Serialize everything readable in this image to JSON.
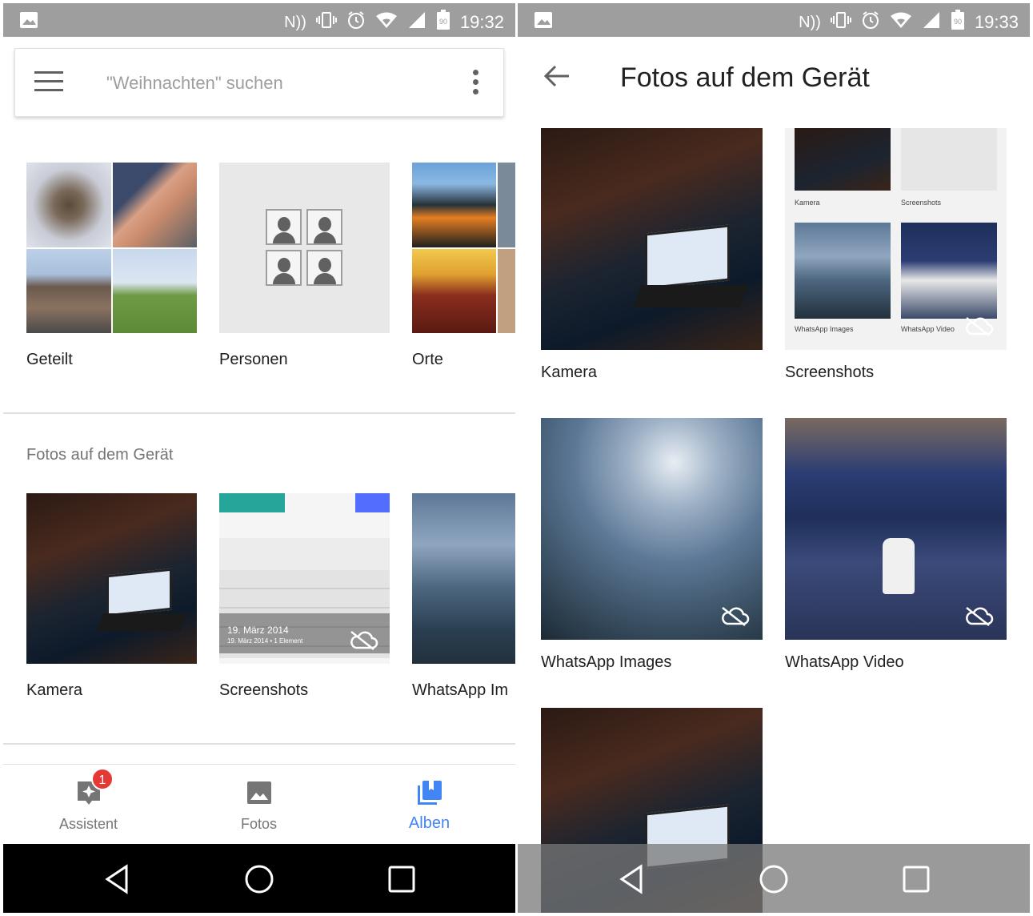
{
  "left": {
    "status": {
      "time": "19:32",
      "battery": "90"
    },
    "search": {
      "placeholder": "\"Weihnachten\" suchen"
    },
    "albums_top": [
      {
        "label": "Geteilt"
      },
      {
        "label": "Personen"
      },
      {
        "label": "Orte"
      }
    ],
    "device_section": {
      "title": "Fotos auf dem Gerät",
      "items": [
        {
          "label": "Kamera"
        },
        {
          "label": "Screenshots",
          "overlay_date": "19. März 2014",
          "overlay_sub": "19. März 2014 • 1 Element"
        },
        {
          "label": "WhatsApp Im"
        }
      ]
    },
    "bottom_nav": {
      "items": [
        {
          "label": "Assistent",
          "icon": "assistant-icon",
          "badge": "1"
        },
        {
          "label": "Fotos",
          "icon": "photo-icon"
        },
        {
          "label": "Alben",
          "icon": "albums-icon",
          "active": true
        }
      ]
    }
  },
  "right": {
    "status": {
      "time": "19:33",
      "battery": "90"
    },
    "title": "Fotos auf dem Gerät",
    "folders": [
      {
        "label": "Kamera"
      },
      {
        "label": "Screenshots",
        "mini_labels": [
          "Kamera",
          "Screenshots",
          "WhatsApp Images",
          "WhatsApp Video"
        ]
      },
      {
        "label": "WhatsApp Images"
      },
      {
        "label": "WhatsApp Video"
      }
    ]
  },
  "colors": {
    "accent": "#4285f4",
    "statusbar": "#9e9e9e",
    "badge": "#e53935"
  }
}
